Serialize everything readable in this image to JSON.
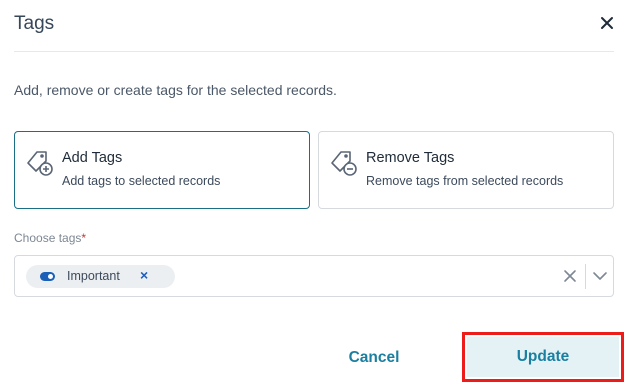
{
  "dialog": {
    "title": "Tags",
    "description": "Add, remove or create tags for the selected records."
  },
  "options": {
    "add": {
      "title": "Add Tags",
      "subtitle": "Add tags to selected records",
      "icon": "tag-add-icon",
      "selected": true
    },
    "remove": {
      "title": "Remove Tags",
      "subtitle": "Remove tags from selected records",
      "icon": "tag-remove-icon",
      "selected": false
    }
  },
  "field": {
    "label": "Choose tags",
    "required_marker": "*",
    "selected_tags": [
      {
        "label": "Important",
        "color": "#1b5fb9"
      }
    ]
  },
  "footer": {
    "cancel_label": "Cancel",
    "update_label": "Update"
  },
  "colors": {
    "accent": "#1a7fa0",
    "selected_border": "#1a6f86",
    "highlight": "#ee1b1b",
    "tag_blue": "#1b5fb9"
  }
}
